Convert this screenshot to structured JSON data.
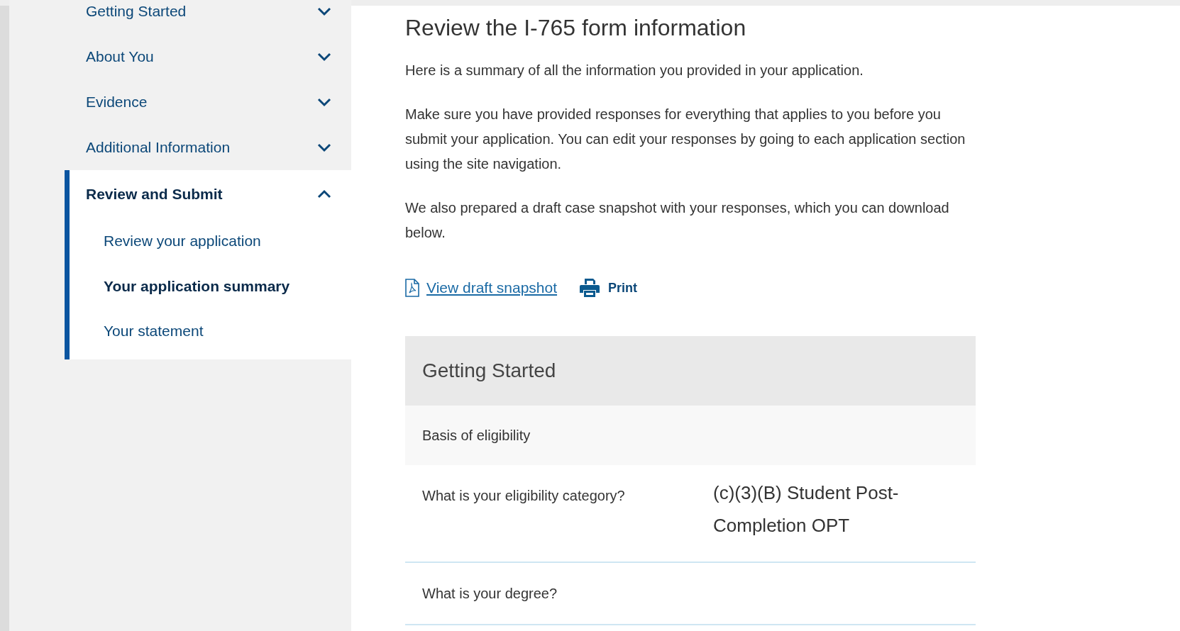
{
  "sidebar": {
    "items": [
      {
        "label": "Getting Started",
        "expanded": false,
        "selected": false
      },
      {
        "label": "About You",
        "expanded": false,
        "selected": false
      },
      {
        "label": "Evidence",
        "expanded": false,
        "selected": false
      },
      {
        "label": "Additional Information",
        "expanded": false,
        "selected": false
      },
      {
        "label": "Review and Submit",
        "expanded": true,
        "selected": true,
        "children": [
          {
            "label": "Review your application",
            "selected": false
          },
          {
            "label": "Your application summary",
            "selected": true
          },
          {
            "label": "Your statement",
            "selected": false
          }
        ]
      }
    ]
  },
  "main": {
    "title": "Review the I-765 form information",
    "paragraphs": [
      "Here is a summary of all the information you provided in your application.",
      "Make sure you have provided responses for everything that applies to you before you submit your application. You can edit your responses by going to each application section using the site navigation.",
      "We also prepared a draft case snapshot with your responses, which you can download below."
    ],
    "actions": [
      {
        "kind": "link",
        "label": "View draft snapshot"
      },
      {
        "kind": "print",
        "label": "Print"
      }
    ],
    "summary": {
      "title": "Getting Started",
      "rows": [
        {
          "kind": "subheading",
          "label": "Basis of eligibility"
        },
        {
          "kind": "qa",
          "question": "What is your eligibility category?",
          "answer": "(c)(3)(B) Student Post-Completion OPT"
        },
        {
          "kind": "qa",
          "question": "What is your degree?"
        }
      ]
    }
  }
}
